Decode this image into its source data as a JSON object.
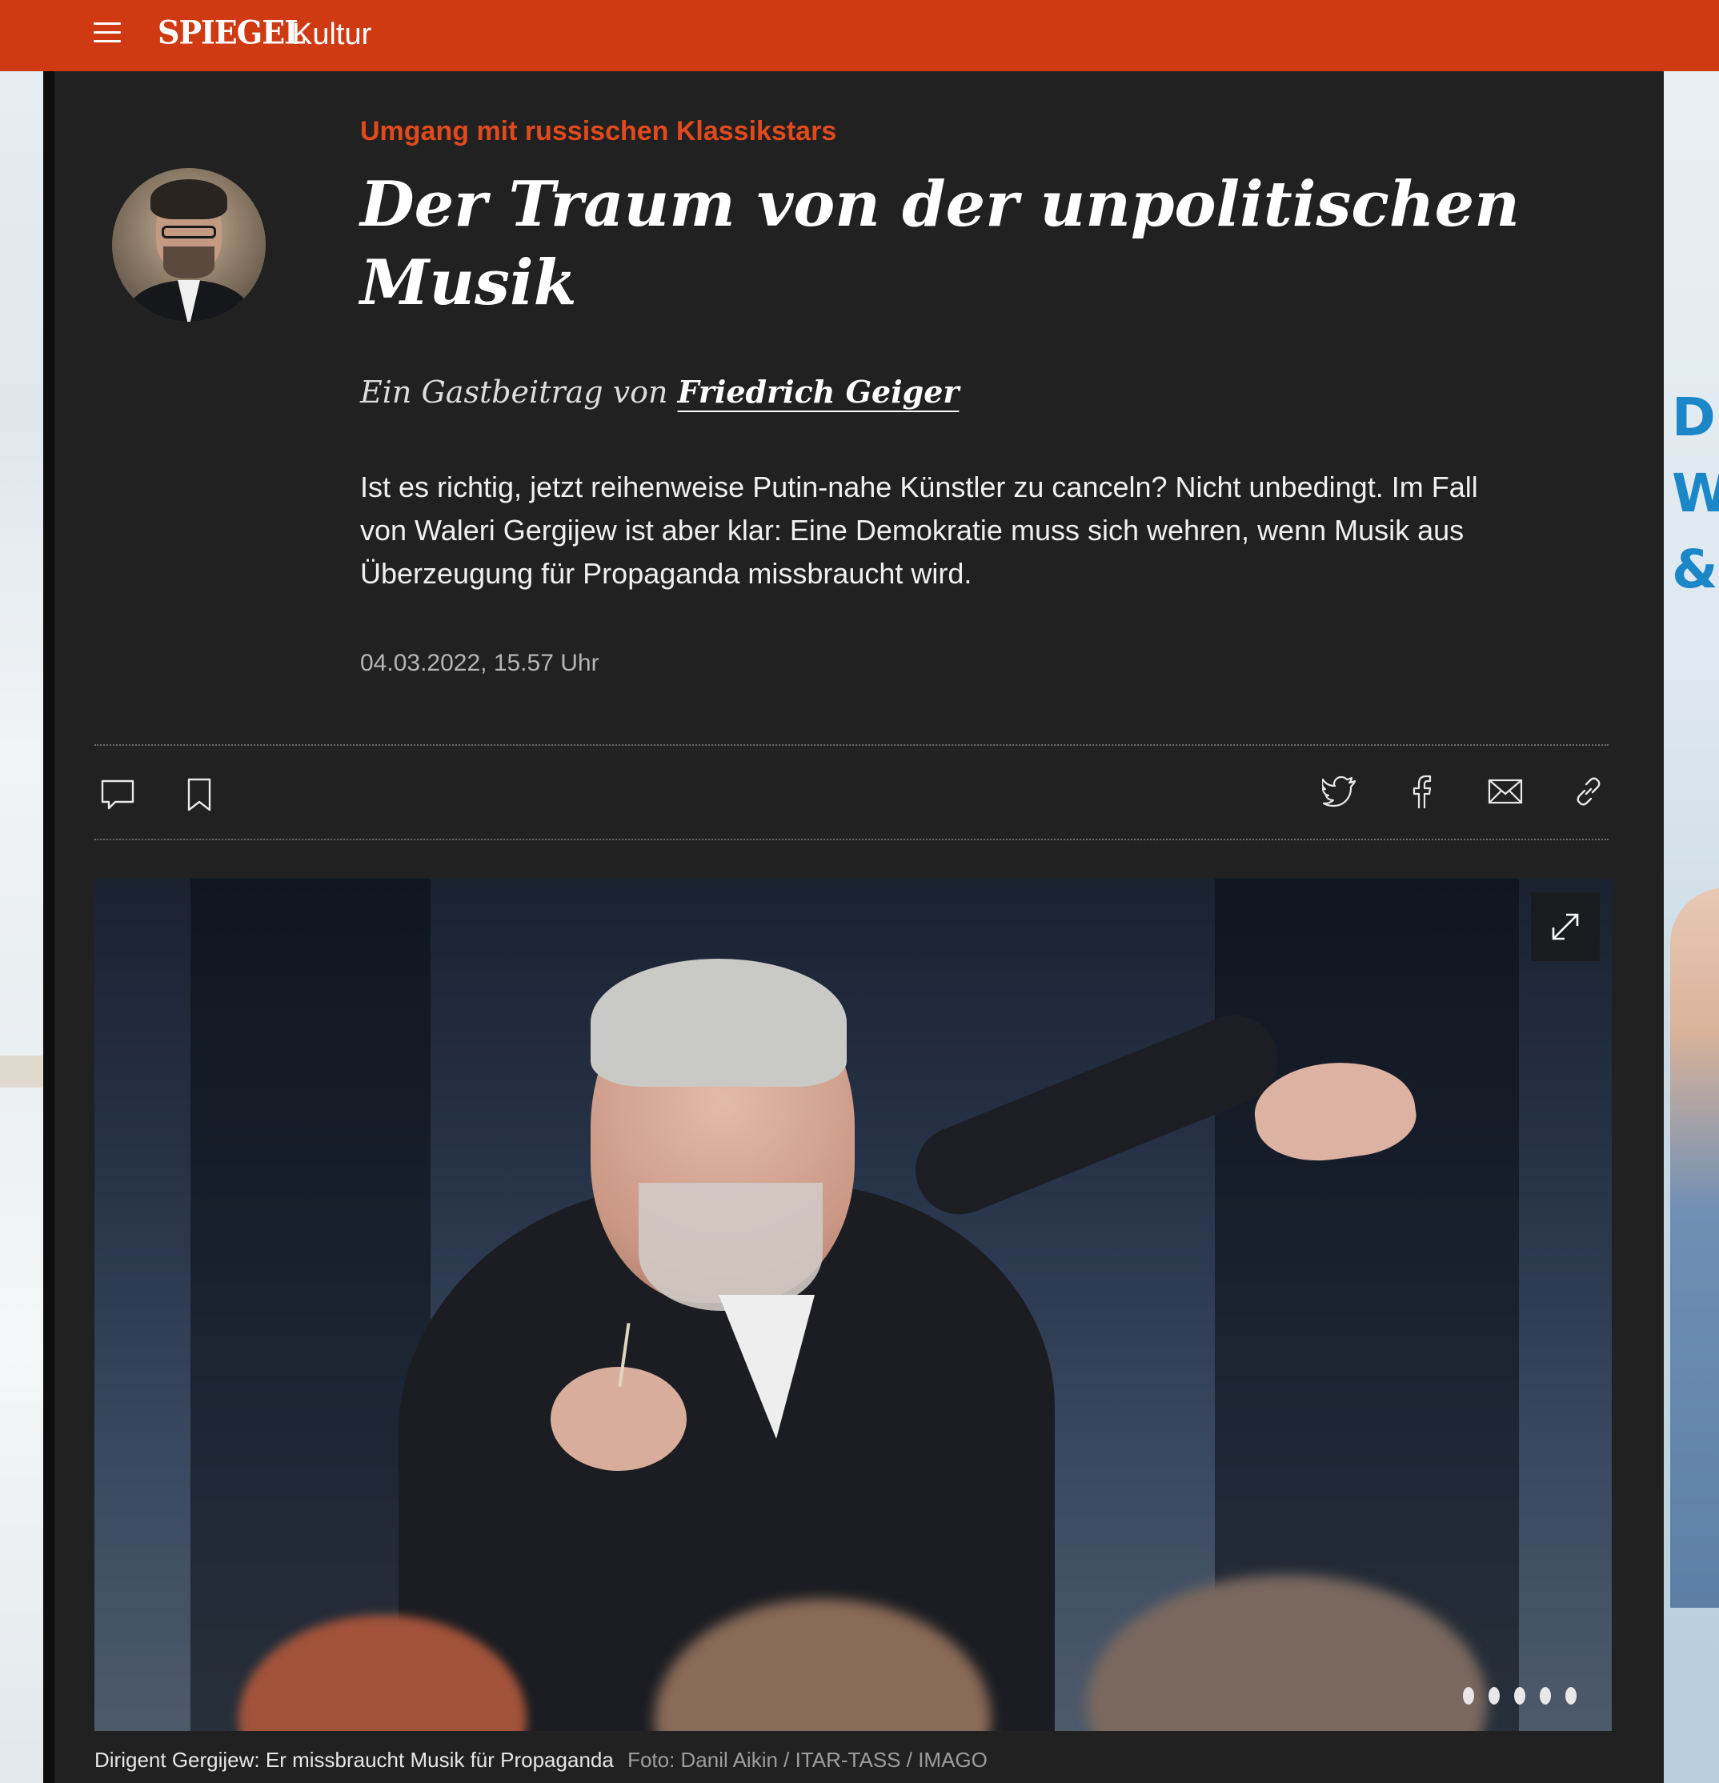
{
  "header": {
    "brand": "SPIEGEL",
    "section": "Kultur",
    "bar_color": "#d03a12"
  },
  "article": {
    "kicker": "Umgang mit russischen Klassikstars",
    "headline": "Der Traum von der unpolitischen Musik",
    "byline_prefix": "Ein Gastbeitrag von",
    "author": "Friedrich Geiger",
    "teaser": "Ist es richtig, jetzt reihenweise Putin-nahe Künstler zu canceln? Nicht unbedingt. Im Fall von Waleri Gergijew ist aber klar: Eine Demokratie muss sich wehren, wenn Musik aus Überzeugung für Propaganda missbraucht wird.",
    "date": "04.03.2022, 15.57 Uhr",
    "kicker_color": "#e14a1c"
  },
  "toolbar": {
    "left_icons": [
      "comment-icon",
      "bookmark-icon"
    ],
    "right_icons": [
      "twitter-icon",
      "facebook-icon",
      "mail-icon",
      "link-icon"
    ]
  },
  "image": {
    "caption": "Dirigent Gergijew: Er missbraucht Musik für Propaganda",
    "credit": "Foto: Danil Aikin / ITAR-TASS / IMAGO"
  },
  "ad_right": {
    "lines": [
      "D",
      "W",
      "&"
    ],
    "color": "#1b86c8"
  }
}
